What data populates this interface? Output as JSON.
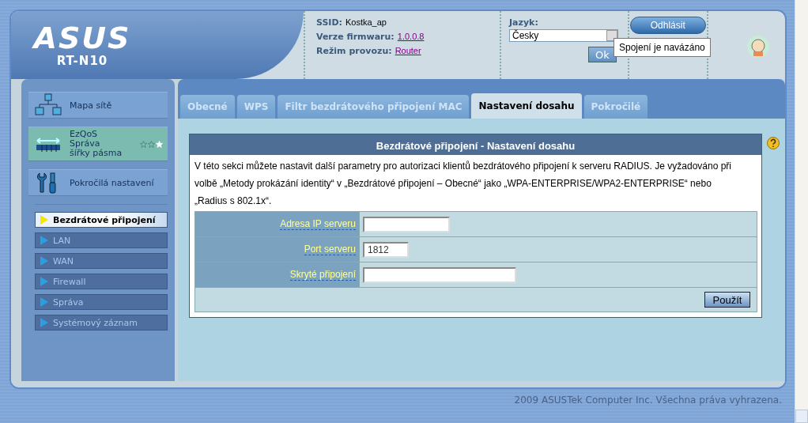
{
  "header": {
    "logo": "ASUS",
    "model": "RT-N10",
    "info": [
      {
        "label": "SSID:",
        "value": "Kostka_ap",
        "kind": "text"
      },
      {
        "label": "Verze firmwaru:",
        "value": "1.0.0.8",
        "kind": "link"
      },
      {
        "label": "Režim provozu:",
        "value": "Router",
        "kind": "link"
      }
    ],
    "language": {
      "label": "Jazyk:",
      "value": "Česky",
      "button": "Ok"
    },
    "logout": "Odhlásit",
    "status_tooltip": "Spojení je navázáno"
  },
  "sidebar": {
    "menu": [
      {
        "kind": "network",
        "label": "Mapa sítě",
        "selected": false
      },
      {
        "kind": "qos",
        "lines": [
          "EzQoS",
          "Správa",
          "šířky pásma"
        ],
        "selected": true,
        "stars": 1
      },
      {
        "kind": "tools",
        "label": "Pokročilá nastavení",
        "selected": false
      }
    ],
    "submenu": [
      {
        "label": "Bezdrátové připojení",
        "selected": true
      },
      {
        "label": "LAN",
        "selected": false
      },
      {
        "label": "WAN",
        "selected": false
      },
      {
        "label": "Firewall",
        "selected": false
      },
      {
        "label": "Správa",
        "selected": false
      },
      {
        "label": "Systémový záznam",
        "selected": false
      }
    ]
  },
  "tabs": [
    {
      "label": "Obecné",
      "selected": false
    },
    {
      "label": "WPS",
      "selected": false
    },
    {
      "label": "Filtr bezdrátového připojení MAC",
      "selected": false
    },
    {
      "label": "Nastavení dosahu",
      "selected": true
    },
    {
      "label": "Pokročilé",
      "selected": false
    }
  ],
  "panel": {
    "title": "Bezdrátové připojení - Nastavení dosahu",
    "description": "V této sekci můžete nastavit další parametry pro autorizaci klientů bezdrátového připojení k serveru RADIUS. Je vyžadováno při volbě „Metody prokázání identity“ v „Bezdrátové připojení – Obecné“ jako „WPA-ENTERPRISE/WPA2-ENTERPRISE“ nebo „Radius s 802.1x“.",
    "fields": [
      {
        "label": "Adresa IP serveru"
      },
      {
        "label": "Port serveru",
        "value": "1812"
      },
      {
        "label": "Skryté připojení"
      }
    ],
    "apply": "Použít"
  },
  "footer": "2009 ASUSTek Computer Inc. Všechna práva vyhrazena."
}
